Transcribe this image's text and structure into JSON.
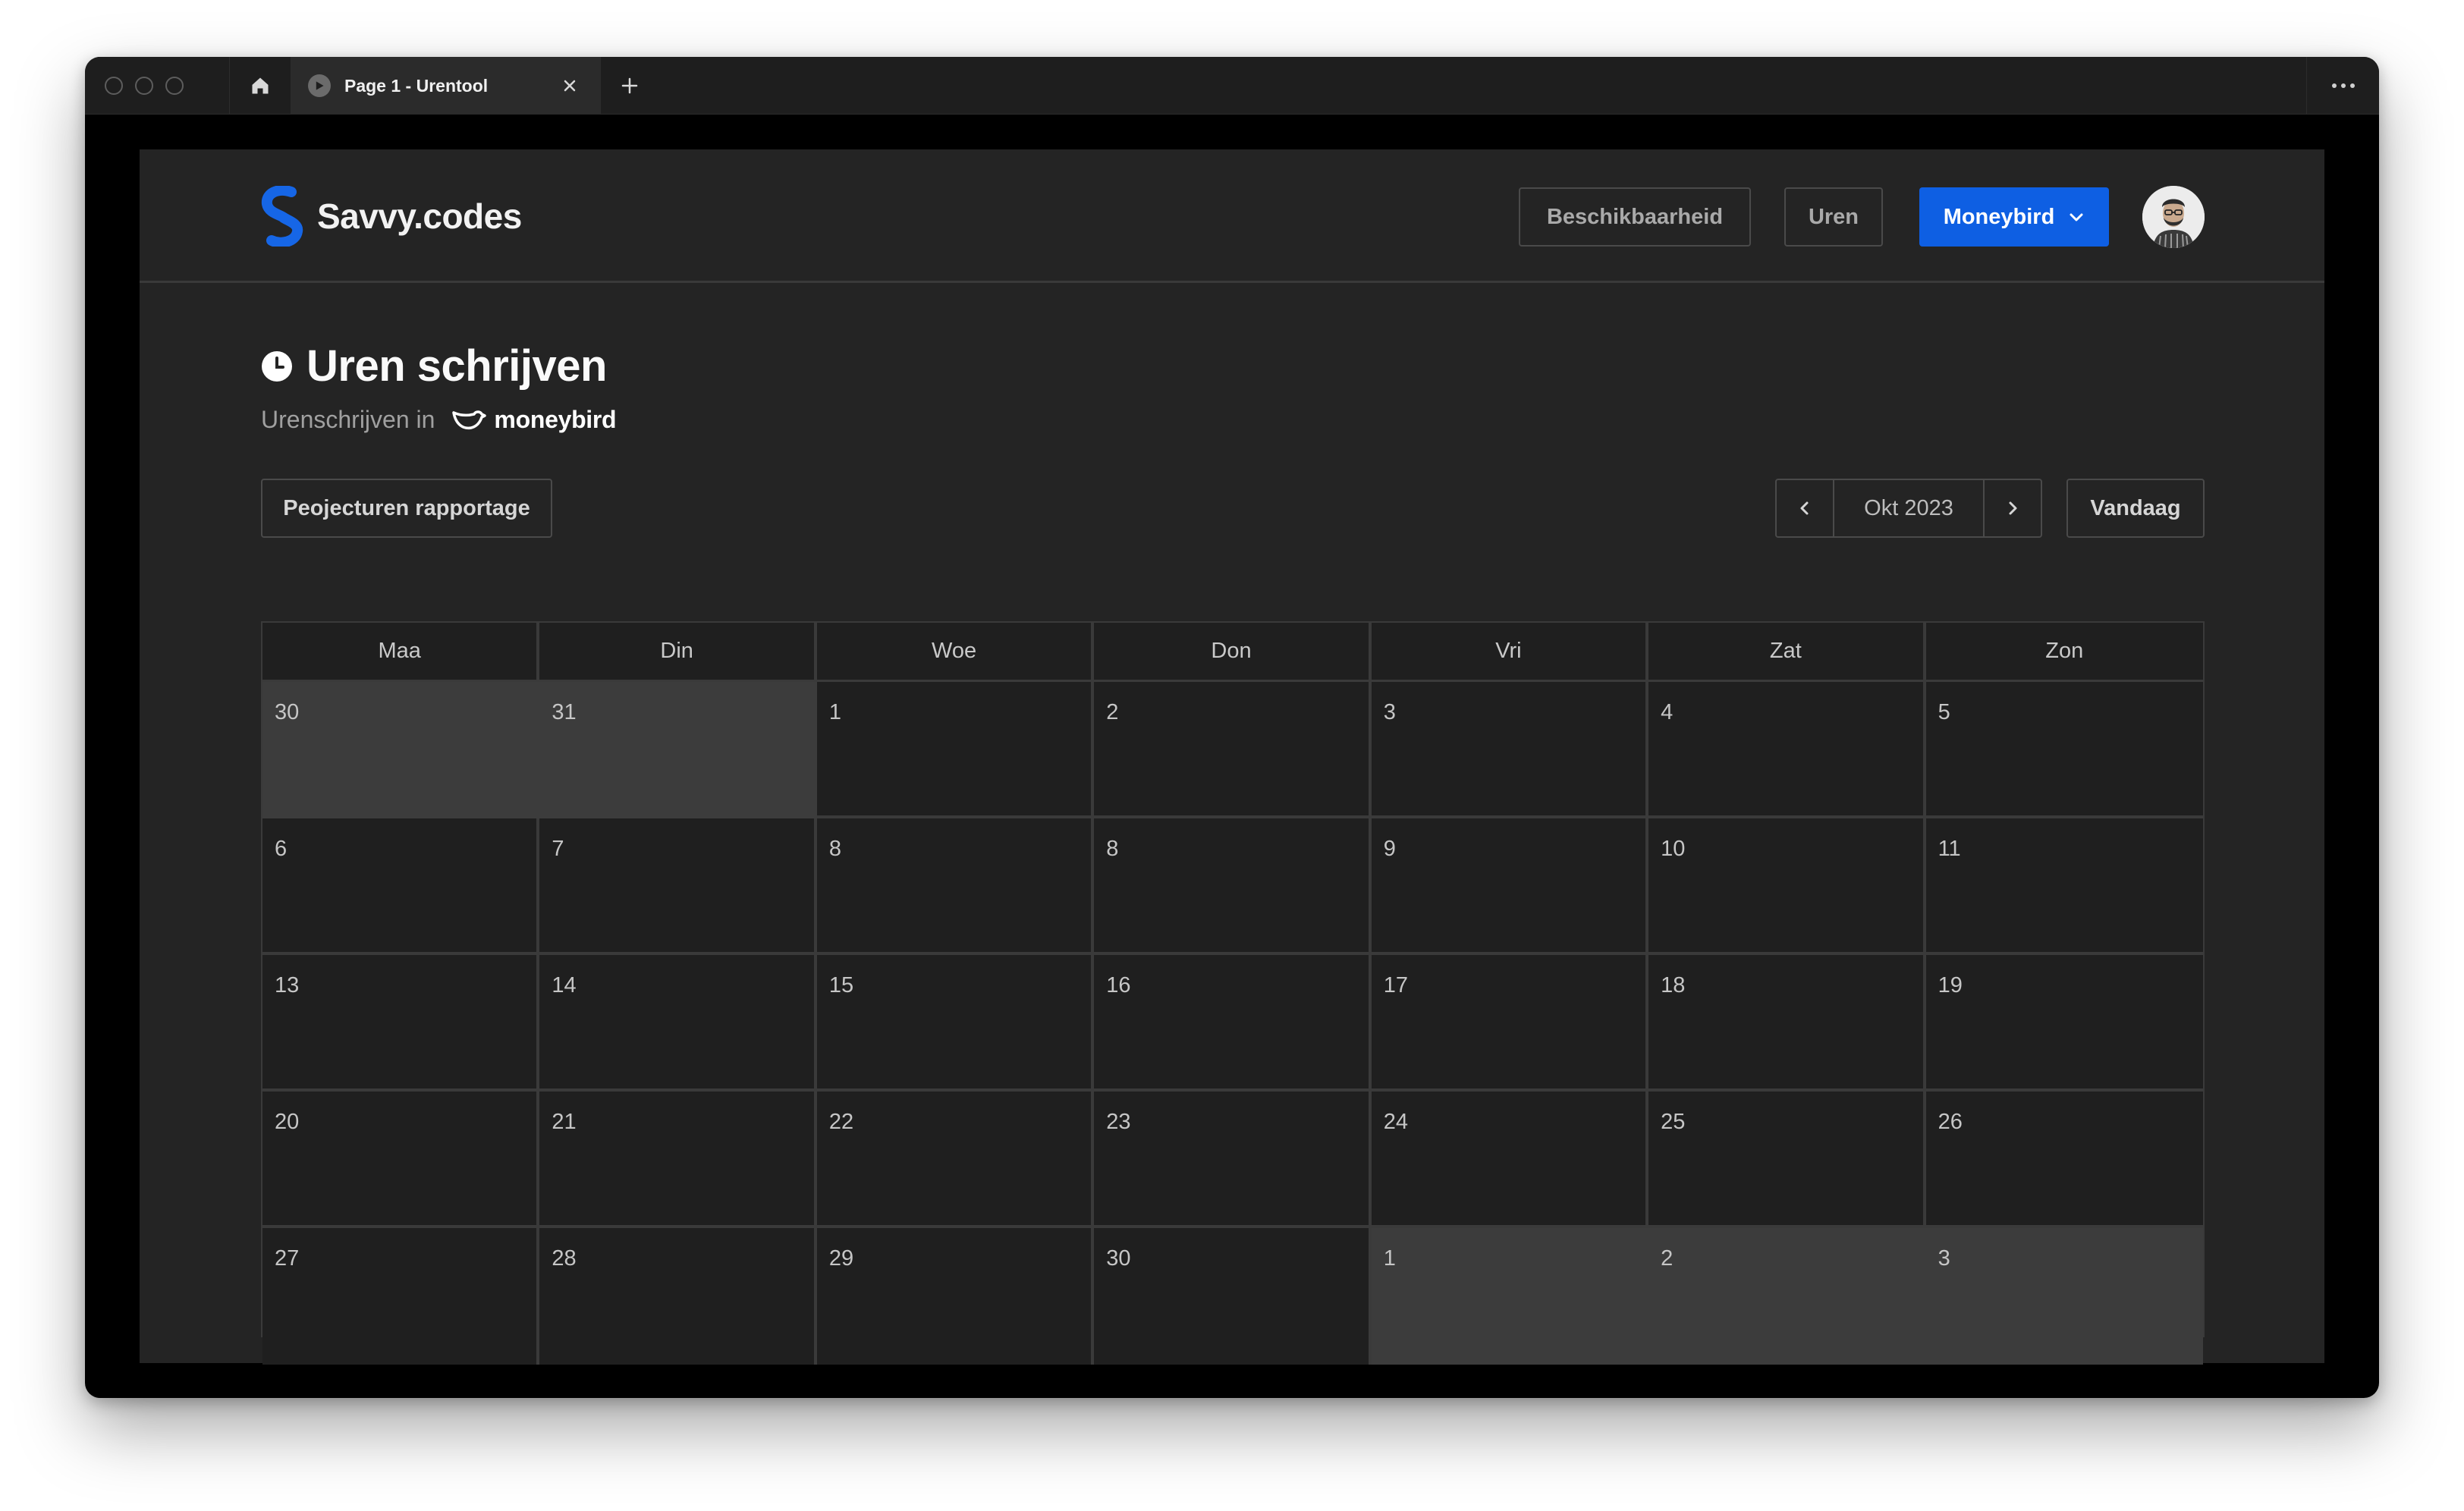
{
  "browser": {
    "tab_title": "Page 1 - Urentool"
  },
  "header": {
    "logo_text": "Savvy.codes",
    "nav": {
      "availability_label": "Beschikbaarheid",
      "hours_label": "Uren",
      "moneybird_label": "Moneybird"
    },
    "accent_color": "#0e5fe3"
  },
  "page": {
    "title": "Uren schrijven",
    "subtitle": "Urenschrijven in",
    "integration_logo": "moneybird"
  },
  "toolbar": {
    "report_label": "Peojecturen rapportage",
    "month_label": "Okt 2023",
    "today_label": "Vandaag"
  },
  "calendar": {
    "weekdays": [
      "Maa",
      "Din",
      "Woe",
      "Don",
      "Vri",
      "Zat",
      "Zon"
    ],
    "days": [
      {
        "label": "30",
        "current": false
      },
      {
        "label": "31",
        "current": false
      },
      {
        "label": "1",
        "current": true
      },
      {
        "label": "2",
        "current": true
      },
      {
        "label": "3",
        "current": true
      },
      {
        "label": "4",
        "current": true
      },
      {
        "label": "5",
        "current": true
      },
      {
        "label": "6",
        "current": true
      },
      {
        "label": "7",
        "current": true
      },
      {
        "label": "8",
        "current": true
      },
      {
        "label": "8",
        "current": true
      },
      {
        "label": "9",
        "current": true
      },
      {
        "label": "10",
        "current": true
      },
      {
        "label": "11",
        "current": true
      },
      {
        "label": "13",
        "current": true
      },
      {
        "label": "14",
        "current": true
      },
      {
        "label": "15",
        "current": true
      },
      {
        "label": "16",
        "current": true
      },
      {
        "label": "17",
        "current": true
      },
      {
        "label": "18",
        "current": true
      },
      {
        "label": "19",
        "current": true
      },
      {
        "label": "20",
        "current": true
      },
      {
        "label": "21",
        "current": true
      },
      {
        "label": "22",
        "current": true
      },
      {
        "label": "23",
        "current": true
      },
      {
        "label": "24",
        "current": true
      },
      {
        "label": "25",
        "current": true
      },
      {
        "label": "26",
        "current": true
      },
      {
        "label": "27",
        "current": true
      },
      {
        "label": "28",
        "current": true
      },
      {
        "label": "29",
        "current": true
      },
      {
        "label": "30",
        "current": true
      },
      {
        "label": "1",
        "current": false
      },
      {
        "label": "2",
        "current": false
      },
      {
        "label": "3",
        "current": false
      }
    ]
  }
}
